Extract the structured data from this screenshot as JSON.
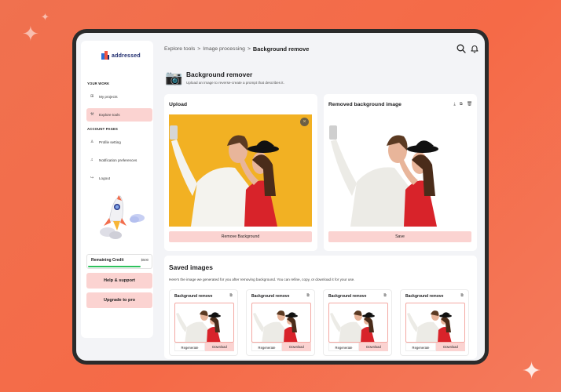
{
  "brand": {
    "logo_text": "addressed"
  },
  "sidebar": {
    "section_your_work": "YOUR WORK",
    "section_account": "ACCOUNT PAGES",
    "items": [
      {
        "label": "My projects",
        "icon": "grid-icon"
      },
      {
        "label": "Explore tools",
        "icon": "tools-icon",
        "active": true
      },
      {
        "label": "Profile setting",
        "icon": "user-icon"
      },
      {
        "label": "Notification preferences",
        "icon": "bell-icon"
      },
      {
        "label": "Logout",
        "icon": "logout-icon"
      }
    ],
    "credit": {
      "label": "Remaining Credit",
      "value": "$500",
      "level": 0.82
    },
    "help_label": "Help & support",
    "upgrade_label": "Upgrade to pro"
  },
  "header": {
    "crumbs": [
      "Explore tools",
      ">",
      "Image processing",
      ">"
    ],
    "current": "Background remove",
    "icons": [
      "search-icon",
      "bell-icon"
    ]
  },
  "tool": {
    "icon": "camera-icon",
    "title": "Background remover",
    "subtitle": "Upload an image to reverse-create a prompt that describes it."
  },
  "upload": {
    "title": "Upload",
    "button": "Remove Background",
    "close_icon": "close-icon"
  },
  "removed": {
    "title": "Removed background image",
    "icons": [
      "download-icon",
      "copy-icon",
      "trash-icon"
    ],
    "button": "Save"
  },
  "saved": {
    "title": "Saved images",
    "description": "Here's the image we generated for you after removing background. You can refine, copy, or download it for your use.",
    "cards": [
      {
        "title": "Background remove",
        "regen": "Regenerate",
        "download": "Download"
      },
      {
        "title": "Background remove",
        "regen": "Regenerate",
        "download": "Download"
      },
      {
        "title": "Background remove",
        "regen": "Regenerate",
        "download": "Download"
      },
      {
        "title": "Background remove",
        "regen": "Regenerate",
        "download": "Download"
      }
    ]
  },
  "colors": {
    "accent_pink": "#fbd3d1",
    "background_orange": "#f26d4c",
    "photo_yellow": "#f2b123",
    "credit_green": "#2fc15d"
  }
}
